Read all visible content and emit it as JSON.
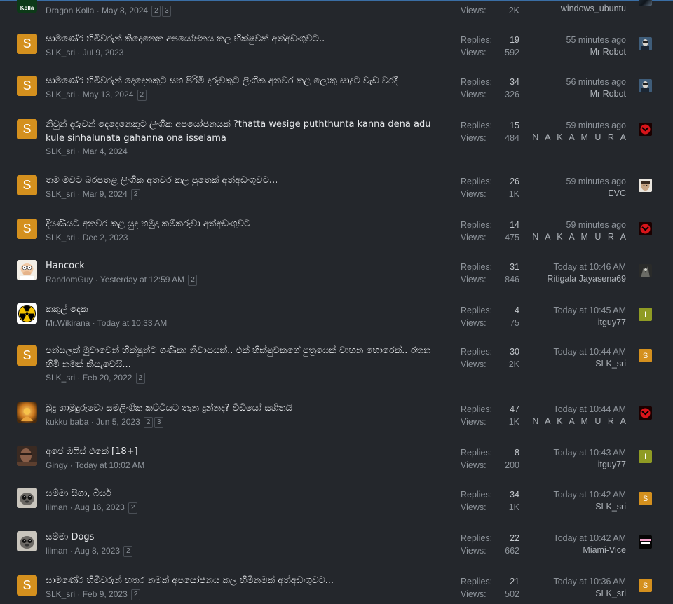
{
  "labels": {
    "replies": "Replies:",
    "views": "Views:"
  },
  "top_partial": {
    "author": "Dragon Kolla",
    "date": "May 8, 2024",
    "pages": [
      "2",
      "3"
    ],
    "views": "2K",
    "last_user": "windows_ubuntu",
    "avatar_text": "Kolla"
  },
  "threads": [
    {
      "title": "සාමණේර හිමිවරුන් කිදෙනෙකු අපයෝජනය කල භික්ෂුවක් අත්අඩංගුවට..",
      "author": "SLK_sri",
      "date": "Jul 9, 2023",
      "pages": [],
      "replies": "19",
      "views": "592",
      "last_time": "55 minutes ago",
      "last_user": "Mr Robot",
      "avatar": {
        "type": "letter",
        "text": "S"
      },
      "mini": {
        "type": "image",
        "name": "mr-robot-avatar"
      }
    },
    {
      "title": "සාමණේර හිමිවරුන් දෙදෙනකුට සහ පිරිමි දරුවකුට ලිංගික අතවර කළ ලොකු සාදුට වැඩ වරදී",
      "author": "SLK_sri",
      "date": "May 13, 2024",
      "pages": [
        "2"
      ],
      "replies": "34",
      "views": "326",
      "last_time": "56 minutes ago",
      "last_user": "Mr Robot",
      "avatar": {
        "type": "letter",
        "text": "S"
      },
      "mini": {
        "type": "image",
        "name": "mr-robot-avatar"
      }
    },
    {
      "title": "නිවුන් දරුවන් දෙදෙනෙකුට ලිංගික අපයෝජනයක් ?thatta wesige puththunta kanna dena adu kule sinhalunata gahanna ona isselama",
      "author": "SLK_sri",
      "date": "Mar 4, 2024",
      "pages": [],
      "replies": "15",
      "views": "484",
      "last_time": "59 minutes ago",
      "last_user": "N A K A M U R A",
      "avatar": {
        "type": "letter",
        "text": "S"
      },
      "mini": {
        "type": "image",
        "name": "nakamura-avatar"
      }
    },
    {
      "title": "තම මවට බරපතළ ලිංගික අතවර කල පුතෙක් අත්අඩංගුවට...",
      "author": "SLK_sri",
      "date": "Mar 9, 2024",
      "pages": [
        "2"
      ],
      "replies": "26",
      "views": "1K",
      "last_time": "59 minutes ago",
      "last_user": "EVC",
      "avatar": {
        "type": "letter",
        "text": "S"
      },
      "mini": {
        "type": "image",
        "name": "evc-avatar"
      }
    },
    {
      "title": "දියණියට අතවර කළ යුද හමුදා කම්කරුවා අත්අඩංගුවට",
      "author": "SLK_sri",
      "date": "Dec 2, 2023",
      "pages": [],
      "replies": "14",
      "views": "475",
      "last_time": "59 minutes ago",
      "last_user": "N A K A M U R A",
      "avatar": {
        "type": "letter",
        "text": "S"
      },
      "mini": {
        "type": "image",
        "name": "nakamura-avatar"
      }
    },
    {
      "title": "Hancock",
      "author": "RandomGuy",
      "date": "Yesterday at 12:59 AM",
      "pages": [
        "2"
      ],
      "replies": "31",
      "views": "846",
      "last_time": "Today at 10:46 AM",
      "last_user": "Ritigala Jayasena69",
      "avatar": {
        "type": "image",
        "name": "peter-griffin-avatar"
      },
      "mini": {
        "type": "image",
        "name": "ritigala-avatar"
      }
    },
    {
      "title": "කකුල් දෙක",
      "author": "Mr.Wikirana",
      "date": "Today at 10:33 AM",
      "pages": [],
      "replies": "4",
      "views": "75",
      "last_time": "Today at 10:45 AM",
      "last_user": "itguy77",
      "avatar": {
        "type": "image",
        "name": "radiation-symbol-avatar"
      },
      "mini": {
        "type": "letter",
        "text": "I"
      }
    },
    {
      "title": "පන්සලක් මුවාවෙන් භික්ෂූන්ට ගණිකා නිවාසයක්.. එක් භික්ෂුවකගේ පුත්‍රයෙක් වාහන හොරෙක්.. රතන හිමි නමක් කියැවෙයි...",
      "author": "SLK_sri",
      "date": "Feb 20, 2022",
      "pages": [
        "2"
      ],
      "replies": "30",
      "views": "2K",
      "last_time": "Today at 10:44 AM",
      "last_user": "SLK_sri",
      "avatar": {
        "type": "letter",
        "text": "S"
      },
      "mini": {
        "type": "letter",
        "text": "S"
      }
    },
    {
      "title": "බුදු හාමුදුරුවො සමලිංගික කට්ටියට තැන දුන්නද? වීඩියෝ සහිතයි",
      "author": "kukku baba",
      "date": "Jun 5, 2023",
      "pages": [
        "2",
        "3"
      ],
      "replies": "47",
      "views": "1K",
      "last_time": "Today at 10:44 AM",
      "last_user": "N A K A M U R A",
      "avatar": {
        "type": "image",
        "name": "golden-statue-avatar"
      },
      "mini": {
        "type": "image",
        "name": "nakamura-avatar"
      }
    },
    {
      "title": "අපේ ඔෆිස් එකේ [18+]",
      "author": "Gingy",
      "date": "Today at 10:02 AM",
      "pages": [],
      "replies": "8",
      "views": "200",
      "last_time": "Today at 10:43 AM",
      "last_user": "itguy77",
      "avatar": {
        "type": "image",
        "name": "portrait-avatar"
      },
      "mini": {
        "type": "letter",
        "text": "I"
      }
    },
    {
      "title": "සම්මා සිගා, බියර්",
      "author": "lilman",
      "date": "Aug 16, 2023",
      "pages": [
        "2"
      ],
      "replies": "34",
      "views": "1K",
      "last_time": "Today at 10:42 AM",
      "last_user": "SLK_sri",
      "avatar": {
        "type": "image",
        "name": "sad-cat-avatar"
      },
      "mini": {
        "type": "letter",
        "text": "S"
      }
    },
    {
      "title": "සම්මා Dogs",
      "author": "lilman",
      "date": "Aug 8, 2023",
      "pages": [
        "2"
      ],
      "replies": "22",
      "views": "662",
      "last_time": "Today at 10:42 AM",
      "last_user": "Miami-Vice",
      "avatar": {
        "type": "image",
        "name": "sad-cat-avatar"
      },
      "mini": {
        "type": "image",
        "name": "miami-vice-avatar"
      }
    },
    {
      "title": "සාමණේර හිමිවරුන් හතර නමක් අපයෝජනය කල හිමිනමක් අත්අඩංගුවට...",
      "author": "SLK_sri",
      "date": "Feb 9, 2023",
      "pages": [
        "2"
      ],
      "replies": "21",
      "views": "502",
      "last_time": "Today at 10:36 AM",
      "last_user": "SLK_sri",
      "avatar": {
        "type": "letter",
        "text": "S"
      },
      "mini": {
        "type": "letter",
        "text": "S"
      }
    }
  ]
}
